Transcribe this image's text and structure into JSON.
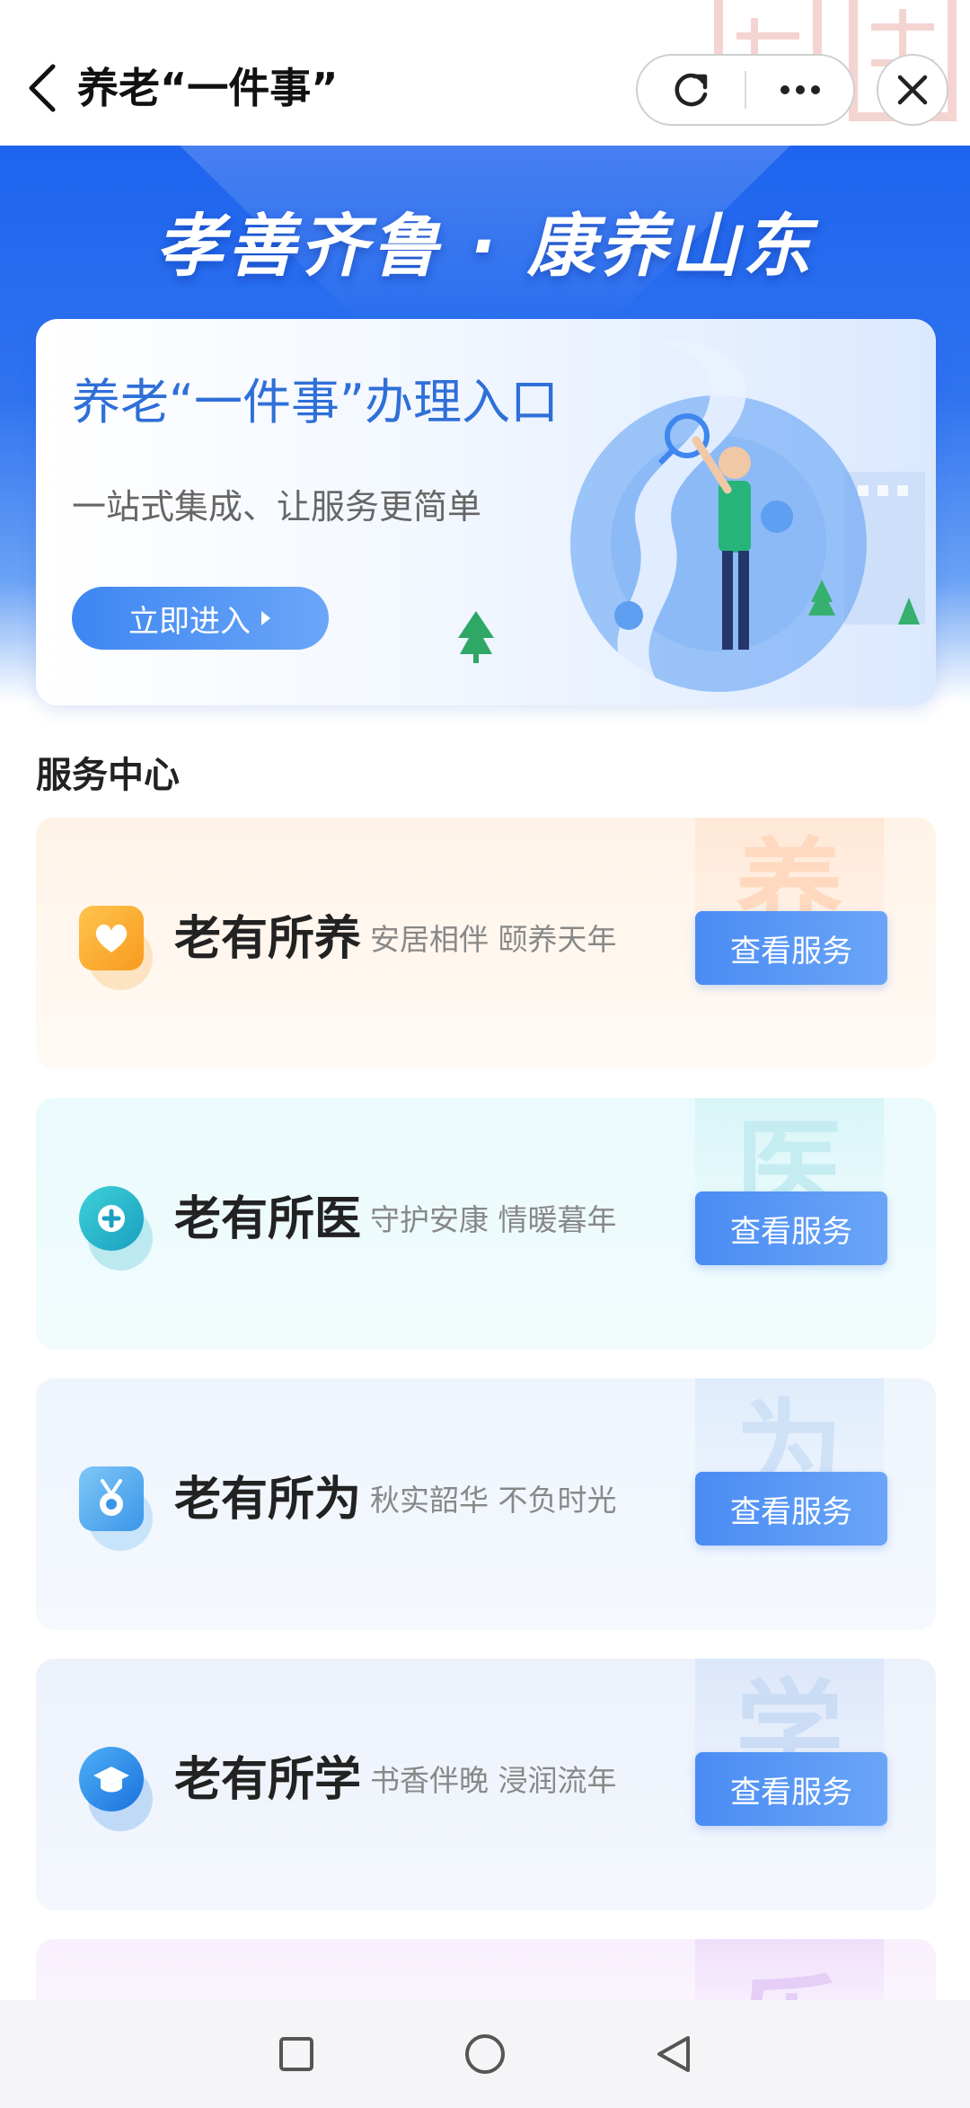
{
  "header": {
    "title": "养老“一件事”",
    "refresh_icon": "refresh-icon",
    "more_icon": "more-icon",
    "close_icon": "close-icon",
    "back_icon": "back-arrow-icon"
  },
  "hero": {
    "slogan": "孝善齐鲁 · 康养山东",
    "entry_title": "养老“一件事”办理入口",
    "entry_subtitle": "一站式集成、让服务更简单",
    "entry_button": "立即进入"
  },
  "services": {
    "section_title": "服务中心",
    "items": [
      {
        "name": "老有所养",
        "desc": "安居相伴 颐养天年",
        "button": "查看服务",
        "watermark": "养",
        "icon": "heart-icon",
        "accent": "#f7a935",
        "bg": "#fff6ee"
      },
      {
        "name": "老有所医",
        "desc": "守护安康 情暖暮年",
        "button": "查看服务",
        "watermark": "医",
        "icon": "medical-plus-icon",
        "accent": "#1fb5c9",
        "bg": "#eefbfc"
      },
      {
        "name": "老有所为",
        "desc": "秋实韶华 不负时光",
        "button": "查看服务",
        "watermark": "为",
        "icon": "medal-icon",
        "accent": "#4aa7ee",
        "bg": "#f1f7fd"
      },
      {
        "name": "老有所学",
        "desc": "书香伴晚 浸润流年",
        "button": "查看服务",
        "watermark": "学",
        "icon": "graduation-cap-icon",
        "accent": "#2f86e6",
        "bg": "#eff4fc"
      },
      {
        "name": "",
        "desc": "",
        "button": "",
        "watermark": "乐",
        "icon": "",
        "accent": "#b88fe8",
        "bg": "#f8f1fd"
      }
    ]
  },
  "colors": {
    "primary": "#2f6fd8",
    "hero_blue": "#1e64ee",
    "button_blue": "#4a8cf4"
  }
}
